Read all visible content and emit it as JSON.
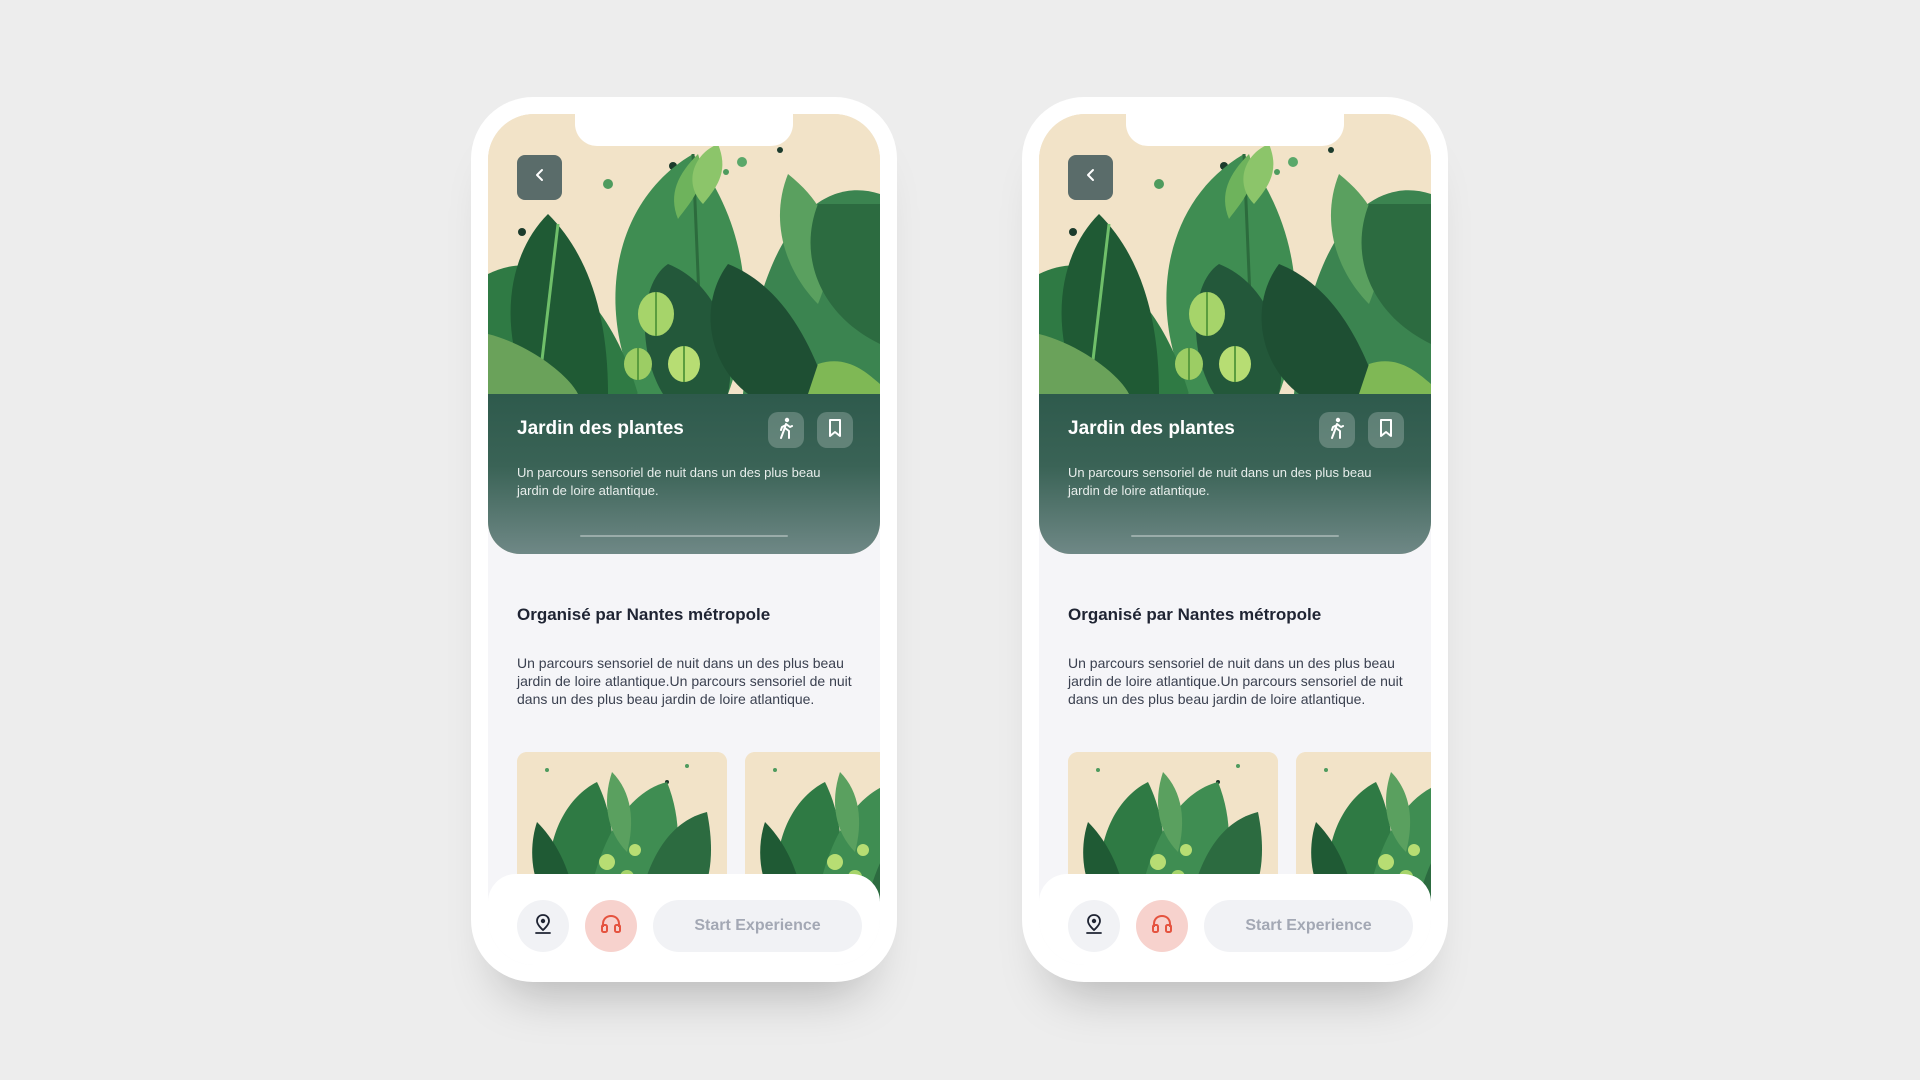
{
  "colors": {
    "background": "#ededed",
    "hero_panel": "#2e5a4c",
    "accent_audio": "#e5533f",
    "audio_button_bg": "#f7d2cd",
    "title_text": "#1f2433",
    "button_disabled_text": "#a3a8b4"
  },
  "screens": [
    {
      "hero": {
        "title": "Jardin des plantes",
        "description": "Un parcours sensoriel de nuit dans un des plus beau jardin de loire atlantique.",
        "back_icon": "chevron-left-icon",
        "action_icons": [
          "walking-person-icon",
          "bookmark-icon"
        ]
      },
      "organizer_title": "Organisé par Nantes métropole",
      "organizer_description": "Un parcours sensoriel de nuit dans un des plus beau jardin de loire atlantique.Un parcours sensoriel de nuit dans un des plus beau jardin de loire atlantique.",
      "bottom_bar": {
        "location_icon": "map-pin-icon",
        "audio_icon": "headphones-icon",
        "start_label": "Start Experience"
      }
    },
    {
      "hero": {
        "title": "Jardin des plantes",
        "description": "Un parcours sensoriel de nuit dans un des plus beau jardin de loire atlantique.",
        "back_icon": "chevron-left-icon",
        "action_icons": [
          "walking-person-icon",
          "bookmark-icon"
        ]
      },
      "organizer_title": "Organisé par Nantes métropole",
      "organizer_description": "Un parcours sensoriel de nuit dans un des plus beau jardin de loire atlantique.Un parcours sensoriel de nuit dans un des plus beau jardin de loire atlantique.",
      "bottom_bar": {
        "location_icon": "map-pin-icon",
        "audio_icon": "headphones-icon",
        "start_label": "Start Experience"
      }
    }
  ]
}
